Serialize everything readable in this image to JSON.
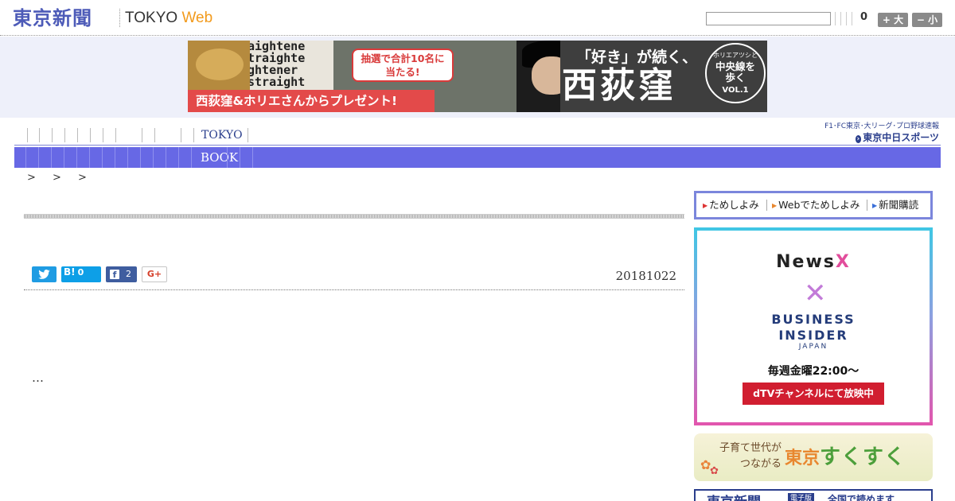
{
  "header": {
    "logo_jp": "東京新聞",
    "logo_en_tokyo": "TOKYO",
    "logo_en_web": "Web",
    "search_value": "",
    "count": "0",
    "font_large_label": "+ 大",
    "font_small_label": "− 小"
  },
  "banner": {
    "sign_lines": [
      "aightene",
      "traighte",
      "ghtener",
      "straight"
    ],
    "bubble_line1": "抽選で合計10名に",
    "bubble_line2": "当たる!",
    "red_strip": "西荻窪&ホリエさんからプレゼント!",
    "catch": "「好き」が続く、",
    "title": "西荻窪",
    "circle_small": "ホリエアツシと",
    "circle_main_1": "中央線を",
    "circle_main_2": "歩く",
    "circle_vol": "VOL.1"
  },
  "nav": {
    "sub_tokyo": "TOKYO",
    "main_book": "BOOK",
    "chunichi_line1": "F1･FC東京･大リーグ･プロ野球速報",
    "chunichi_prefix": "東京",
    "chunichi_name": "中日スポーツ"
  },
  "breadcrumb": [
    ">",
    ">",
    ">"
  ],
  "article": {
    "share_hatena_label": "B!",
    "share_hatena_count": "0",
    "share_facebook_count": "2",
    "share_gplus_label": "G+",
    "date": "20181022",
    "body": "…"
  },
  "sidebar": {
    "tame_items": [
      "ためしよみ",
      "Webでためしよみ",
      "新聞購読"
    ],
    "ad": {
      "newsx_main": "News",
      "newsx_x": "X",
      "cross": "✕",
      "bi_line1": "BUSINESS",
      "bi_line2": "INSIDER",
      "bi_sub": "JAPAN",
      "time": "毎週金曜22:00〜",
      "dtv": "dTVチャンネルにて放映中"
    },
    "sukusuku": {
      "sub_1": "子育て世代が",
      "sub_2": "つながる",
      "tokyo": "東京",
      "name": "すくすく"
    },
    "epaper": {
      "logo": "東京新聞",
      "tag": "電子版",
      "text": "全国で読めます"
    }
  },
  "colors": {
    "brand_blue": "#4d5bb8",
    "nav_bar": "#6768e5",
    "banner_band": "#eef0fa",
    "accent_orange": "#f29a1c",
    "dtv_red": "#d11e30"
  }
}
